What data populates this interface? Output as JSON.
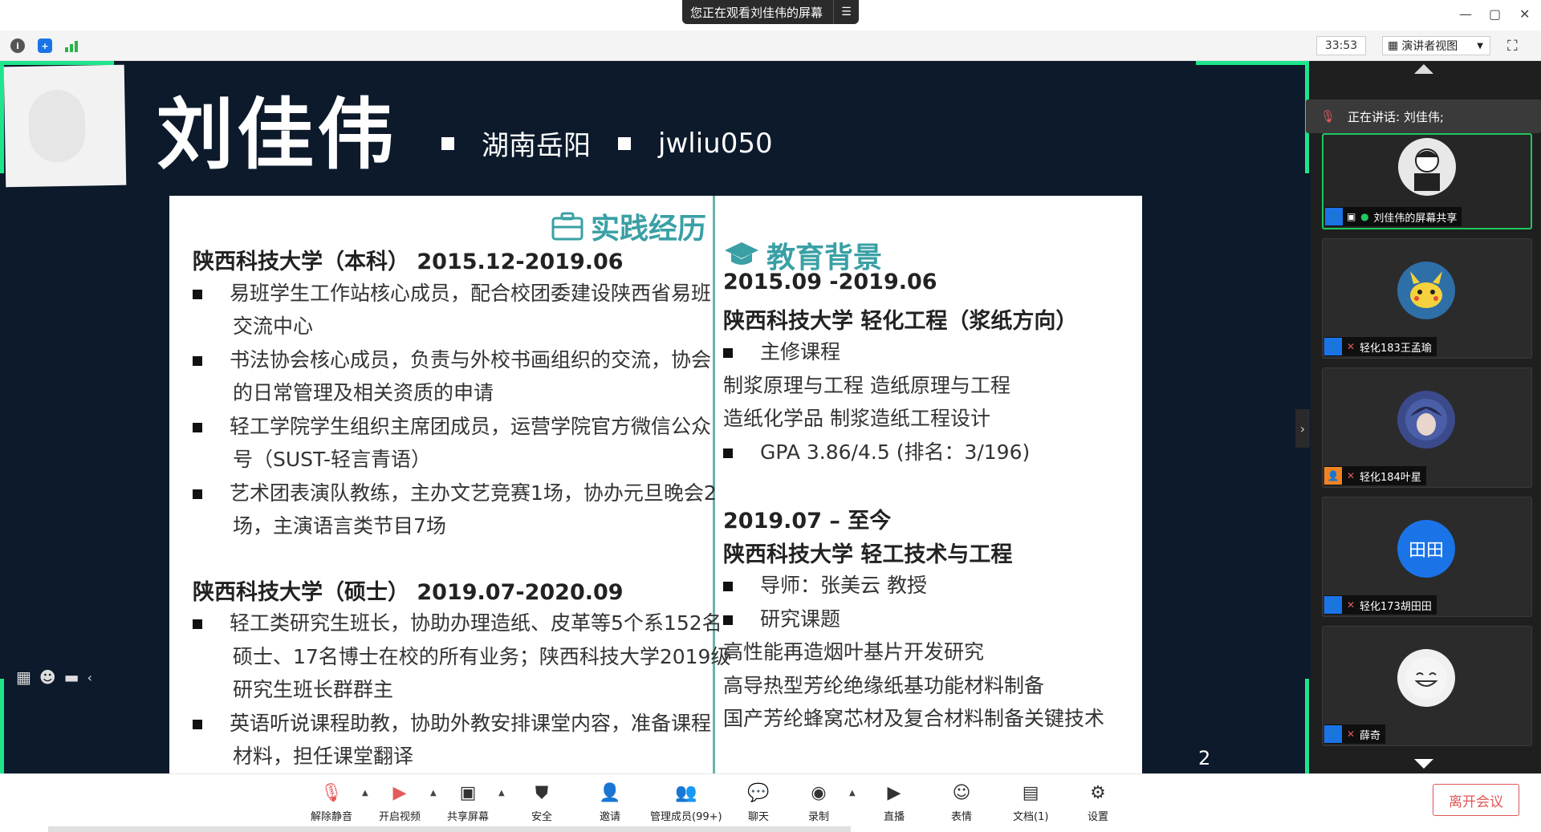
{
  "titlebar": {
    "share_banner": "您正在观看刘佳伟的屏幕",
    "menu_icon": "menu-icon",
    "window_controls": [
      "—",
      "▢",
      "✕"
    ]
  },
  "toolrow": {
    "timer": "33:53",
    "view_selector": "演讲者视图",
    "icons": [
      "info-icon",
      "shield-icon",
      "signal-icon",
      "fullscreen-icon"
    ]
  },
  "slide": {
    "name": "刘佳伟",
    "hometown": "湖南岳阳",
    "handle": "jwliu050",
    "page_number": "2",
    "left": {
      "heading": "实践经历",
      "heading_icon": "briefcase-icon",
      "lines": [
        {
          "type": "head",
          "text": "陕西科技大学（本科）          2015.12-2019.06"
        },
        {
          "type": "bullet",
          "text": "易班学生工作站核心成员，配合校团委建设陕西省易班"
        },
        {
          "type": "cont",
          "text": "交流中心"
        },
        {
          "type": "bullet",
          "text": "书法协会核心成员，负责与外校书画组织的交流，协会"
        },
        {
          "type": "cont",
          "text": "的日常管理及相关资质的申请"
        },
        {
          "type": "bullet",
          "text": "轻工学院学生组织主席团成员，运营学院官方微信公众"
        },
        {
          "type": "cont",
          "text": "号（SUST-轻言青语）"
        },
        {
          "type": "bullet",
          "text": "艺术团表演队教练，主办文艺竞赛1场，协办元旦晚会2"
        },
        {
          "type": "cont",
          "text": "场，主演语言类节目7场"
        },
        {
          "type": "head",
          "text": "陕西科技大学（硕士）          2019.07-2020.09"
        },
        {
          "type": "bullet",
          "text": "轻工类研究生班长，协助办理造纸、皮革等5个系152名"
        },
        {
          "type": "cont",
          "text": "硕士、17名博士在校的所有业务；陕西科技大学2019级"
        },
        {
          "type": "cont",
          "text": "研究生班长群群主"
        },
        {
          "type": "bullet",
          "text": "英语听说课程助教，协助外教安排课堂内容，准备课程"
        },
        {
          "type": "cont",
          "text": "材料，担任课堂翻译"
        }
      ]
    },
    "right": {
      "heading": "教育背景",
      "heading_icon": "graduation-cap-icon",
      "lines": [
        {
          "type": "head",
          "text": "2015.09  -2019.06"
        },
        {
          "type": "head",
          "text": "陕西科技大学     轻化工程（浆纸方向）"
        },
        {
          "type": "bullet",
          "text": "主修课程"
        },
        {
          "type": "plain",
          "text": "制浆原理与工程  造纸原理与工程"
        },
        {
          "type": "plain",
          "text": "造纸化学品  制浆造纸工程设计"
        },
        {
          "type": "bullet",
          "text": "GPA 3.86/4.5 (排名：3/196)"
        },
        {
          "type": "head",
          "text": "2019.07  –  至今"
        },
        {
          "type": "head",
          "text": "陕西科技大学     轻工技术与工程"
        },
        {
          "type": "bullet",
          "text": "导师：张美云  教授"
        },
        {
          "type": "bullet",
          "text": "研究课题"
        },
        {
          "type": "plain",
          "text": "高性能再造烟叶基片开发研究"
        },
        {
          "type": "plain",
          "text": "高导热型芳纶绝缘纸基功能材料制备"
        },
        {
          "type": "plain",
          "text": "国产芳纶蜂窝芯材及复合材料制备关键技术"
        }
      ]
    }
  },
  "panel": {
    "speaking": "正在讲话: 刘佳伟;",
    "participants": [
      {
        "label": "刘佳伟的屏幕共享",
        "avatar": "user-photo",
        "mic": "mic-on-icon"
      },
      {
        "label": "轻化183王孟瑜",
        "avatar": "pikachu-avatar",
        "mic": "mic-off-icon"
      },
      {
        "label": "轻化184叶星",
        "avatar": "anime-avatar",
        "mic": "mic-off-icon"
      },
      {
        "label": "轻化173胡田田",
        "avatar_text": "田田",
        "mic": "mic-off-icon"
      },
      {
        "label": "薛奇",
        "avatar": "smiley-avatar",
        "mic": "mic-off-icon"
      }
    ]
  },
  "bottombar": {
    "buttons": [
      {
        "label": "解除静音",
        "icon": "mic-muted-icon"
      },
      {
        "label": "开启视频",
        "icon": "video-off-icon"
      },
      {
        "label": "共享屏幕",
        "icon": "share-screen-icon"
      },
      {
        "label": "安全",
        "icon": "shield-icon"
      },
      {
        "label": "邀请",
        "icon": "add-user-icon"
      },
      {
        "label": "管理成员(99+)",
        "icon": "members-icon"
      },
      {
        "label": "聊天",
        "icon": "chat-icon"
      },
      {
        "label": "录制",
        "icon": "record-icon"
      },
      {
        "label": "直播",
        "icon": "live-icon"
      },
      {
        "label": "表情",
        "icon": "emoji-icon"
      },
      {
        "label": "文档(1)",
        "icon": "document-icon"
      },
      {
        "label": "设置",
        "icon": "settings-icon"
      }
    ],
    "leave": "离开会议"
  },
  "colors": {
    "slide_bg": "#0c1a2b",
    "accent_green": "#1ee58c",
    "heading_teal": "#3aa0a5",
    "leave_red": "#e25656",
    "user_blue": "#1a74e8"
  }
}
